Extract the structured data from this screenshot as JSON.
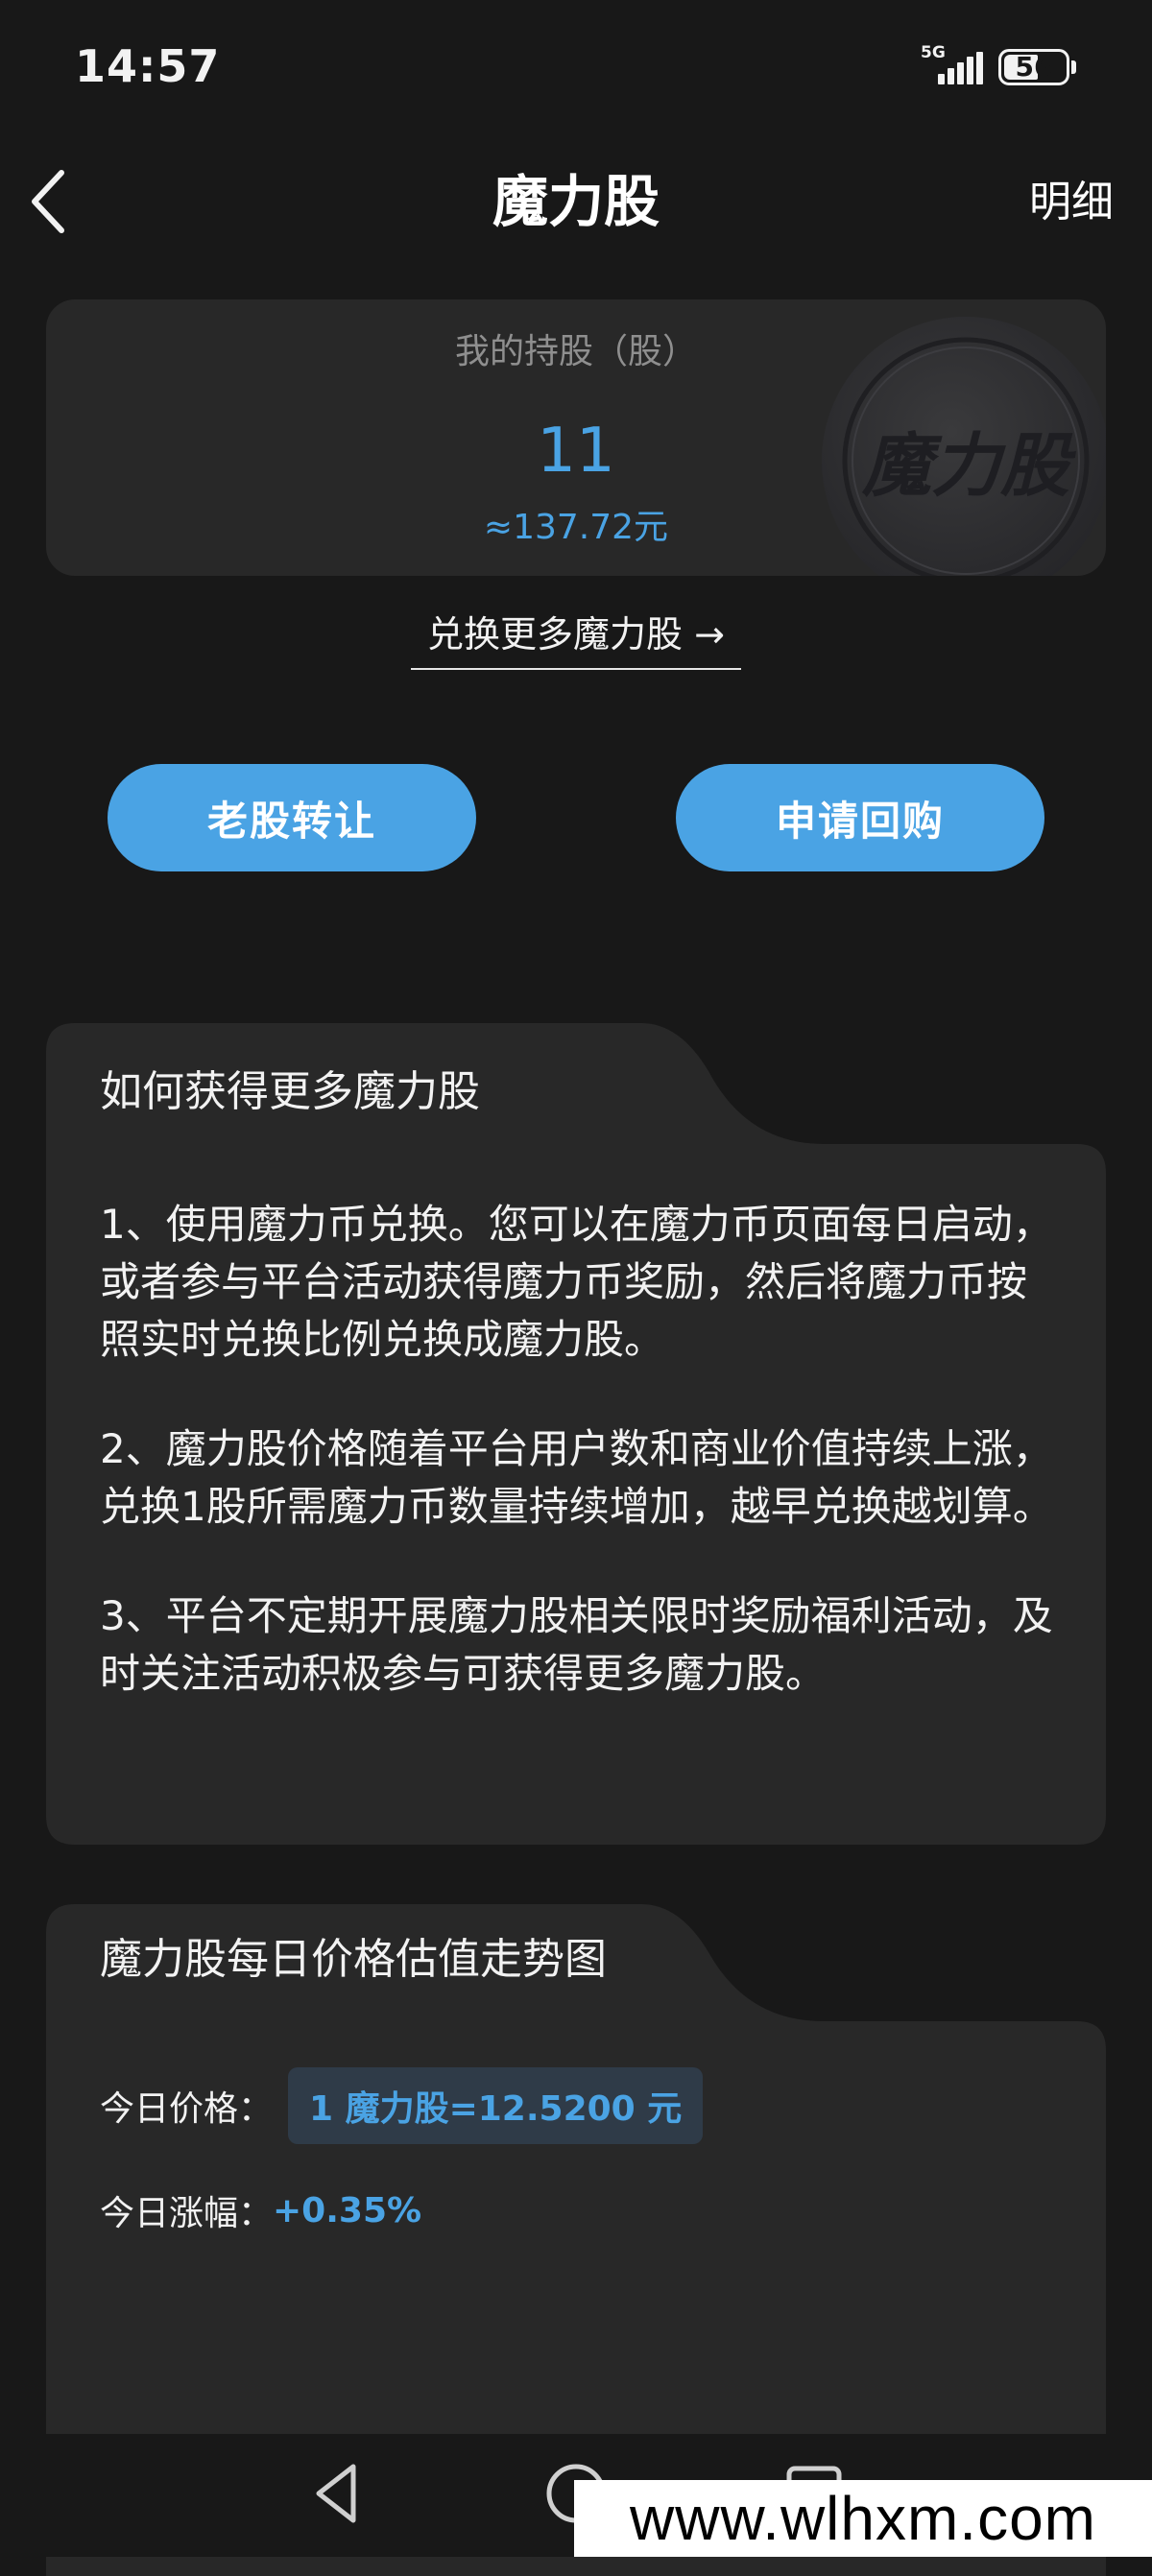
{
  "status_bar": {
    "time": "14:57",
    "network": "5G",
    "battery": "56"
  },
  "header": {
    "title": "魔力股",
    "detail_label": "明细",
    "back_icon": "chevron-left-icon"
  },
  "holdings": {
    "label": "我的持股（股）",
    "value": "11",
    "cny_value": "≈137.72元",
    "coin_text": "魔力股"
  },
  "exchange_link": "兑换更多魔力股 →",
  "actions": {
    "transfer_label": "老股转让",
    "buyback_label": "申请回购"
  },
  "how_to": {
    "title": "如何获得更多魔力股",
    "items": [
      "1、使用魔力币兑换。您可以在魔力币页面每日启动，或者参与平台活动获得魔力币奖励，然后将魔力币按照实时兑换比例兑换成魔力股。",
      "2、魔力股价格随着平台用户数和商业价值持续上涨，兑换1股所需魔力币数量持续增加，越早兑换越划算。",
      "3、平台不定期开展魔力股相关限时奖励福利活动，及时关注活动积极参与可获得更多魔力股。"
    ]
  },
  "trend": {
    "title": "魔力股每日价格估值走势图",
    "price_label": "今日价格：",
    "price_value": "1 魔力股=12.5200 元",
    "change_label": "今日涨幅：",
    "change_value": "+0.35%"
  },
  "nav": {
    "back_icon": "triangle-back-icon",
    "home_icon": "circle-home-icon",
    "recent_icon": "square-recent-icon"
  },
  "watermark": "www.wlhxm.com",
  "colors": {
    "accent": "#4aa3e4",
    "background": "#181818",
    "card": "#282828"
  }
}
